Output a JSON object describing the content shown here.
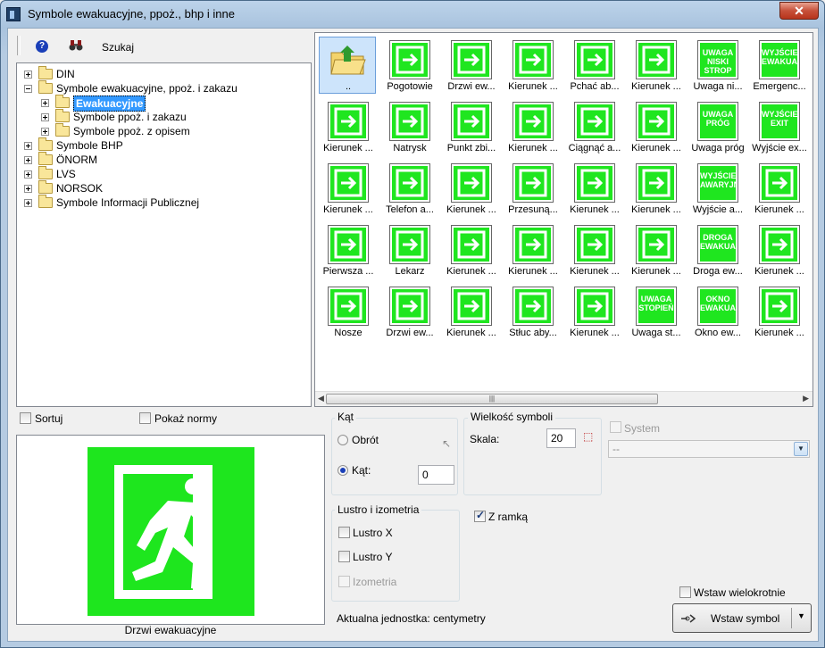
{
  "window": {
    "title": "Symbole ewakuacyjne, ppoż., bhp i inne",
    "close_glyph": "✕"
  },
  "toolbar": {
    "search_label": "Szukaj",
    "help_glyph": "?"
  },
  "tree": [
    {
      "label": "DIN",
      "level": 0,
      "expander": "plus",
      "selected": false
    },
    {
      "label": "Symbole ewakuacyjne, ppoż. i zakazu",
      "level": 0,
      "expander": "minus",
      "selected": false
    },
    {
      "label": "Ewakuacyjne",
      "level": 1,
      "expander": "plus",
      "selected": true
    },
    {
      "label": "Symbole ppoż. i zakazu",
      "level": 1,
      "expander": "plus",
      "selected": false
    },
    {
      "label": "Symbole ppoż. z opisem",
      "level": 1,
      "expander": "plus",
      "selected": false
    },
    {
      "label": "Symbole BHP",
      "level": 0,
      "expander": "plus",
      "selected": false
    },
    {
      "label": "ÖNORM",
      "level": 0,
      "expander": "plus",
      "selected": false
    },
    {
      "label": "LVS",
      "level": 0,
      "expander": "plus",
      "selected": false
    },
    {
      "label": "NORSOK",
      "level": 0,
      "expander": "plus",
      "selected": false
    },
    {
      "label": "Symbole Informacji Publicznej",
      "level": 0,
      "expander": "plus",
      "selected": false
    }
  ],
  "symbols": [
    [
      {
        "label": "..",
        "icon": "folder-up-icon",
        "text": ""
      },
      {
        "label": "Pogotowie",
        "icon": "ambulance-person-icon",
        "text": ""
      },
      {
        "label": "Drzwi ew...",
        "icon": "exit-door-icon",
        "text": ""
      },
      {
        "label": "Kierunek ...",
        "icon": "arrow-down-door-icon",
        "text": ""
      },
      {
        "label": "Pchać ab...",
        "icon": "push-door-icon",
        "text": ""
      },
      {
        "label": "Kierunek ...",
        "icon": "direction-up-icon",
        "text": ""
      },
      {
        "label": "Uwaga ni...",
        "icon": "text-sign-icon",
        "text": "UWAGA NISKI STROP"
      },
      {
        "label": "Emergenc...",
        "icon": "text-sign-icon",
        "text": "WYJŚCIE EWAKUACYJNE"
      }
    ],
    [
      {
        "label": "Kierunek ...",
        "icon": "arrow-right-icon",
        "text": ""
      },
      {
        "label": "Natrysk",
        "icon": "shower-icon",
        "text": ""
      },
      {
        "label": "Punkt zbi...",
        "icon": "assembly-point-icon",
        "text": ""
      },
      {
        "label": "Kierunek ...",
        "icon": "direction-down-icon",
        "text": ""
      },
      {
        "label": "Ciągnąć a...",
        "icon": "pull-door-icon",
        "text": ""
      },
      {
        "label": "Kierunek ...",
        "icon": "direction-down-run-icon",
        "text": ""
      },
      {
        "label": "Uwaga próg",
        "icon": "text-sign-icon",
        "text": "UWAGA PRÓG"
      },
      {
        "label": "Wyjście ex...",
        "icon": "text-sign-icon",
        "text": "WYJŚCIE EXIT"
      }
    ],
    [
      {
        "label": "Kierunek ...",
        "icon": "arrow-down-right-icon",
        "text": ""
      },
      {
        "label": "Telefon a...",
        "icon": "phone-icon",
        "text": ""
      },
      {
        "label": "Kierunek ...",
        "icon": "door-arrow-right-icon",
        "text": ""
      },
      {
        "label": "Przesuną...",
        "icon": "slide-door-icon",
        "text": ""
      },
      {
        "label": "Kierunek ...",
        "icon": "stairs-run-icon",
        "text": ""
      },
      {
        "label": "Kierunek ...",
        "icon": "diag-run-icon",
        "text": ""
      },
      {
        "label": "Wyjście a...",
        "icon": "text-sign-icon",
        "text": "WYJŚCIE AWARYJNE"
      },
      {
        "label": "Kierunek ...",
        "icon": "wheelchair-icon",
        "text": ""
      }
    ],
    [
      {
        "label": "Pierwsza ...",
        "icon": "first-aid-cross-icon",
        "text": ""
      },
      {
        "label": "Lekarz",
        "icon": "caduceus-icon",
        "text": ""
      },
      {
        "label": "Kierunek ...",
        "icon": "door-run-left-icon",
        "text": ""
      },
      {
        "label": "Kierunek ...",
        "icon": "long-arrow-right-icon",
        "text": ""
      },
      {
        "label": "Kierunek ...",
        "icon": "stairs-down-run-icon",
        "text": ""
      },
      {
        "label": "Kierunek ...",
        "icon": "diag-left-run-icon",
        "text": ""
      },
      {
        "label": "Droga ew...",
        "icon": "text-sign-icon",
        "text": "DROGA EWAKUACYJNA"
      },
      {
        "label": "Kierunek ...",
        "icon": "arrow-left-run-icon",
        "text": ""
      }
    ],
    [
      {
        "label": "Nosze",
        "icon": "stretcher-icon",
        "text": ""
      },
      {
        "label": "Drzwi ew...",
        "icon": "exit-door-left-icon",
        "text": ""
      },
      {
        "label": "Kierunek ...",
        "icon": "door-arrow-down-icon",
        "text": ""
      },
      {
        "label": "Stłuc aby...",
        "icon": "break-glass-icon",
        "text": ""
      },
      {
        "label": "Kierunek ...",
        "icon": "door-run-left-icon",
        "text": ""
      },
      {
        "label": "Uwaga st...",
        "icon": "text-sign-icon",
        "text": "UWAGA STOPIEŃ"
      },
      {
        "label": "Okno ew...",
        "icon": "text-sign-icon",
        "text": "OKNO EWAKUACYJNE"
      },
      {
        "label": "Kierunek ...",
        "icon": "stairs-left-run-icon",
        "text": ""
      }
    ]
  ],
  "options": {
    "sort_label": "Sortuj",
    "show_norms_label": "Pokaż normy"
  },
  "angle": {
    "title": "Kąt",
    "rotation_label": "Obrót",
    "angle_label": "Kąt:",
    "angle_value": "0"
  },
  "size": {
    "title": "Wielkość symboli",
    "scale_label": "Skala:",
    "scale_value": "20"
  },
  "system": {
    "label": "System",
    "value": "--"
  },
  "mirror": {
    "title": "Lustro i izometria",
    "x_label": "Lustro X",
    "y_label": "Lustro Y",
    "iso_label": "Izometria"
  },
  "frame": {
    "label": "Z ramką"
  },
  "unit_text": "Aktualna jednostka: centymetry",
  "insert": {
    "multiple_label": "Wstaw wielokrotnie",
    "button_label": "Wstaw symbol"
  },
  "preview": {
    "caption": "Drzwi ewakuacyjne"
  },
  "colors": {
    "sign_green": "#1fe61f",
    "selection_blue": "#3399ff"
  }
}
